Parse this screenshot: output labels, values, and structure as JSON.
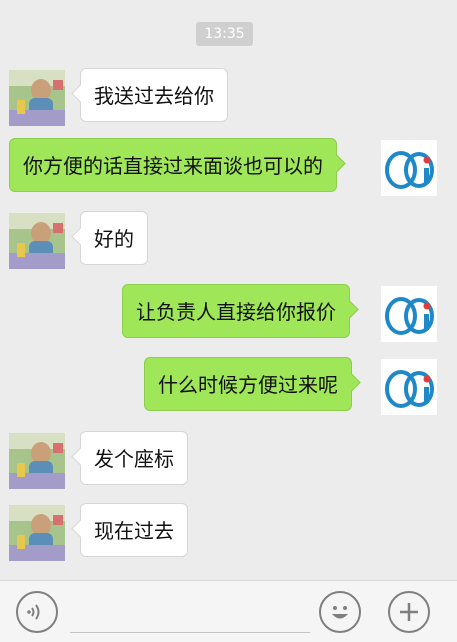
{
  "chat": {
    "timestamp": "13:35",
    "messages": [
      {
        "side": "incoming",
        "text": "我送过去给你"
      },
      {
        "side": "outgoing",
        "text": "你方便的话直接过来面谈也可以的"
      },
      {
        "side": "incoming",
        "text": "好的"
      },
      {
        "side": "outgoing",
        "text": "让负责人直接给你报价"
      },
      {
        "side": "outgoing",
        "text": "什么时候方便过来呢"
      },
      {
        "side": "incoming",
        "text": "发个座标"
      },
      {
        "side": "incoming",
        "text": "现在过去"
      }
    ]
  },
  "input_bar": {
    "left_icon": "voice-icon",
    "right_icons": [
      "emoji-icon",
      "plus-icon"
    ]
  },
  "colors": {
    "outgoing_bubble": "#9fe658",
    "incoming_bubble": "#ffffff",
    "background": "#ececec",
    "timestamp_pill": "#cfcfcf"
  }
}
